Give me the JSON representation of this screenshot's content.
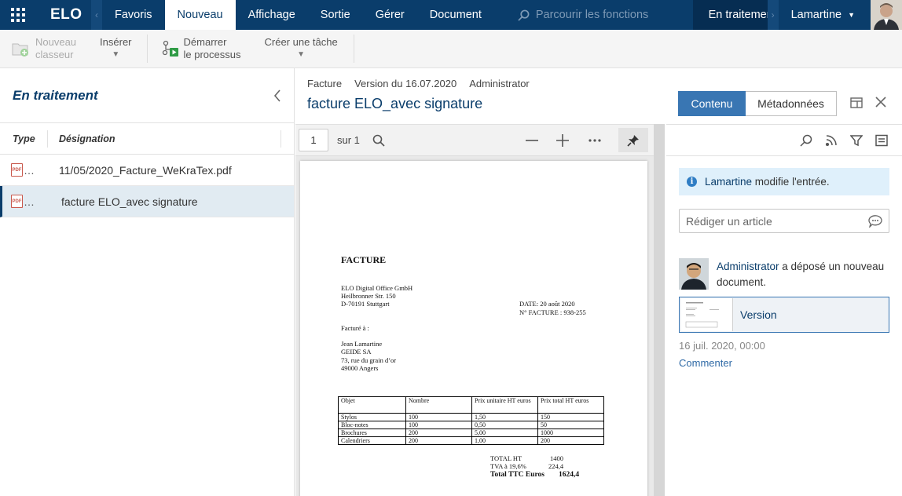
{
  "topbar": {
    "logo": "ELO",
    "menu": [
      {
        "label": "Favoris",
        "active": false
      },
      {
        "label": "Nouveau",
        "active": true
      },
      {
        "label": "Affichage",
        "active": false
      },
      {
        "label": "Sortie",
        "active": false
      },
      {
        "label": "Gérer",
        "active": false
      },
      {
        "label": "Document",
        "active": false
      }
    ],
    "search_placeholder": "Parcourir les fonctions",
    "status_tab": "En traitement",
    "user": "Lamartine",
    "colors": {
      "bar": "#0a3d6b",
      "active_tab": "#ffffff"
    }
  },
  "ribbon": {
    "new_folder_line1": "Nouveau",
    "new_folder_line2": "classeur",
    "insert": "Insérer",
    "start_line1": "Démarrer",
    "start_line2": "le processus",
    "create_task": "Créer une tâche"
  },
  "left": {
    "title": "En traitement",
    "col_type": "Type",
    "col_name": "Désignation",
    "rows": [
      {
        "type": "PDF",
        "name": "11/05/2020_Facture_WeKraTex.pdf",
        "selected": false
      },
      {
        "type": "PDF",
        "name": "facture ELO_avec signature",
        "selected": true
      }
    ]
  },
  "doc": {
    "crumb_type": "Facture",
    "crumb_version": "Version du 16.07.2020",
    "crumb_user": "Administrator",
    "title": "facture ELO_avec signature",
    "tab_content": "Contenu",
    "tab_meta": "Métadonnées"
  },
  "viewer": {
    "page": "1",
    "of_label": "sur 1"
  },
  "invoice": {
    "title": "FACTURE",
    "sender": [
      "ELO Digital Office GmbH",
      "Heilbronner Str. 150",
      "D-70191 Stuttgart"
    ],
    "date": "DATE:  20 août 2020",
    "number": "N° FACTURE : 938-255",
    "billed_to_label": "Facturé à :",
    "recipient": [
      "Jean Lamartine",
      "GEIDE SA",
      "73, rue du grain d’or",
      "49000 Angers"
    ],
    "table_header": [
      "Objet",
      "Nombre",
      "Prix unitaire HT euros",
      "Prix total HT euros"
    ],
    "table_rows": [
      [
        "Stylos",
        "100",
        "1,50",
        "150"
      ],
      [
        "Bloc-notes",
        "100",
        "0,50",
        "50"
      ],
      [
        "Brochures",
        "200",
        "5,00",
        "1000"
      ],
      [
        "Calendriers",
        "200",
        "1,00",
        "200"
      ]
    ],
    "total_ht_label": "TOTAL HT",
    "total_ht": "1400",
    "tva_label": "TVA à 19,6%",
    "tva": "224,4",
    "total_ttc_label": "Total TTC Euros",
    "total_ttc": "1624,4"
  },
  "feed": {
    "info_user": "Lamartine",
    "info_text": " modifie l'entrée.",
    "compose_placeholder": "Rédiger un article",
    "activity_user": "Administrator",
    "activity_text": " a déposé un nouveau document.",
    "version_label": "Version",
    "date": "16 juil. 2020, 00:00",
    "comment": "Commenter"
  }
}
